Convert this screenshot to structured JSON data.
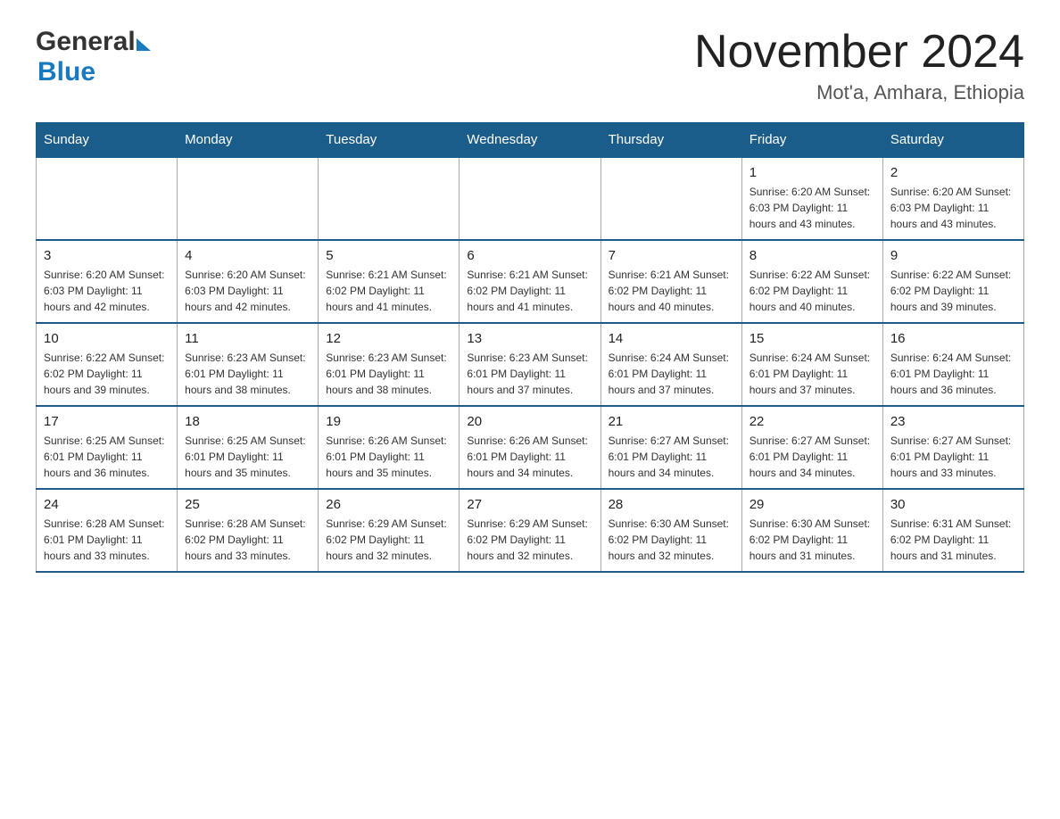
{
  "header": {
    "logo_general": "General",
    "logo_blue": "Blue",
    "main_title": "November 2024",
    "sub_title": "Mot'a, Amhara, Ethiopia"
  },
  "calendar": {
    "days_of_week": [
      "Sunday",
      "Monday",
      "Tuesday",
      "Wednesday",
      "Thursday",
      "Friday",
      "Saturday"
    ],
    "weeks": [
      {
        "cells": [
          {
            "day": "",
            "info": "",
            "empty": true
          },
          {
            "day": "",
            "info": "",
            "empty": true
          },
          {
            "day": "",
            "info": "",
            "empty": true
          },
          {
            "day": "",
            "info": "",
            "empty": true
          },
          {
            "day": "",
            "info": "",
            "empty": true
          },
          {
            "day": "1",
            "info": "Sunrise: 6:20 AM\nSunset: 6:03 PM\nDaylight: 11 hours\nand 43 minutes.",
            "empty": false
          },
          {
            "day": "2",
            "info": "Sunrise: 6:20 AM\nSunset: 6:03 PM\nDaylight: 11 hours\nand 43 minutes.",
            "empty": false
          }
        ]
      },
      {
        "cells": [
          {
            "day": "3",
            "info": "Sunrise: 6:20 AM\nSunset: 6:03 PM\nDaylight: 11 hours\nand 42 minutes.",
            "empty": false
          },
          {
            "day": "4",
            "info": "Sunrise: 6:20 AM\nSunset: 6:03 PM\nDaylight: 11 hours\nand 42 minutes.",
            "empty": false
          },
          {
            "day": "5",
            "info": "Sunrise: 6:21 AM\nSunset: 6:02 PM\nDaylight: 11 hours\nand 41 minutes.",
            "empty": false
          },
          {
            "day": "6",
            "info": "Sunrise: 6:21 AM\nSunset: 6:02 PM\nDaylight: 11 hours\nand 41 minutes.",
            "empty": false
          },
          {
            "day": "7",
            "info": "Sunrise: 6:21 AM\nSunset: 6:02 PM\nDaylight: 11 hours\nand 40 minutes.",
            "empty": false
          },
          {
            "day": "8",
            "info": "Sunrise: 6:22 AM\nSunset: 6:02 PM\nDaylight: 11 hours\nand 40 minutes.",
            "empty": false
          },
          {
            "day": "9",
            "info": "Sunrise: 6:22 AM\nSunset: 6:02 PM\nDaylight: 11 hours\nand 39 minutes.",
            "empty": false
          }
        ]
      },
      {
        "cells": [
          {
            "day": "10",
            "info": "Sunrise: 6:22 AM\nSunset: 6:02 PM\nDaylight: 11 hours\nand 39 minutes.",
            "empty": false
          },
          {
            "day": "11",
            "info": "Sunrise: 6:23 AM\nSunset: 6:01 PM\nDaylight: 11 hours\nand 38 minutes.",
            "empty": false
          },
          {
            "day": "12",
            "info": "Sunrise: 6:23 AM\nSunset: 6:01 PM\nDaylight: 11 hours\nand 38 minutes.",
            "empty": false
          },
          {
            "day": "13",
            "info": "Sunrise: 6:23 AM\nSunset: 6:01 PM\nDaylight: 11 hours\nand 37 minutes.",
            "empty": false
          },
          {
            "day": "14",
            "info": "Sunrise: 6:24 AM\nSunset: 6:01 PM\nDaylight: 11 hours\nand 37 minutes.",
            "empty": false
          },
          {
            "day": "15",
            "info": "Sunrise: 6:24 AM\nSunset: 6:01 PM\nDaylight: 11 hours\nand 37 minutes.",
            "empty": false
          },
          {
            "day": "16",
            "info": "Sunrise: 6:24 AM\nSunset: 6:01 PM\nDaylight: 11 hours\nand 36 minutes.",
            "empty": false
          }
        ]
      },
      {
        "cells": [
          {
            "day": "17",
            "info": "Sunrise: 6:25 AM\nSunset: 6:01 PM\nDaylight: 11 hours\nand 36 minutes.",
            "empty": false
          },
          {
            "day": "18",
            "info": "Sunrise: 6:25 AM\nSunset: 6:01 PM\nDaylight: 11 hours\nand 35 minutes.",
            "empty": false
          },
          {
            "day": "19",
            "info": "Sunrise: 6:26 AM\nSunset: 6:01 PM\nDaylight: 11 hours\nand 35 minutes.",
            "empty": false
          },
          {
            "day": "20",
            "info": "Sunrise: 6:26 AM\nSunset: 6:01 PM\nDaylight: 11 hours\nand 34 minutes.",
            "empty": false
          },
          {
            "day": "21",
            "info": "Sunrise: 6:27 AM\nSunset: 6:01 PM\nDaylight: 11 hours\nand 34 minutes.",
            "empty": false
          },
          {
            "day": "22",
            "info": "Sunrise: 6:27 AM\nSunset: 6:01 PM\nDaylight: 11 hours\nand 34 minutes.",
            "empty": false
          },
          {
            "day": "23",
            "info": "Sunrise: 6:27 AM\nSunset: 6:01 PM\nDaylight: 11 hours\nand 33 minutes.",
            "empty": false
          }
        ]
      },
      {
        "cells": [
          {
            "day": "24",
            "info": "Sunrise: 6:28 AM\nSunset: 6:01 PM\nDaylight: 11 hours\nand 33 minutes.",
            "empty": false
          },
          {
            "day": "25",
            "info": "Sunrise: 6:28 AM\nSunset: 6:02 PM\nDaylight: 11 hours\nand 33 minutes.",
            "empty": false
          },
          {
            "day": "26",
            "info": "Sunrise: 6:29 AM\nSunset: 6:02 PM\nDaylight: 11 hours\nand 32 minutes.",
            "empty": false
          },
          {
            "day": "27",
            "info": "Sunrise: 6:29 AM\nSunset: 6:02 PM\nDaylight: 11 hours\nand 32 minutes.",
            "empty": false
          },
          {
            "day": "28",
            "info": "Sunrise: 6:30 AM\nSunset: 6:02 PM\nDaylight: 11 hours\nand 32 minutes.",
            "empty": false
          },
          {
            "day": "29",
            "info": "Sunrise: 6:30 AM\nSunset: 6:02 PM\nDaylight: 11 hours\nand 31 minutes.",
            "empty": false
          },
          {
            "day": "30",
            "info": "Sunrise: 6:31 AM\nSunset: 6:02 PM\nDaylight: 11 hours\nand 31 minutes.",
            "empty": false
          }
        ]
      }
    ]
  }
}
